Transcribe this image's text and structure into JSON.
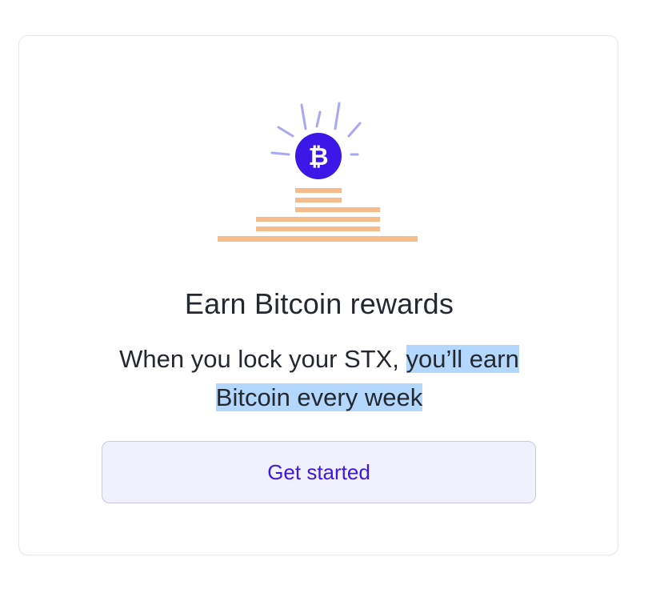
{
  "card": {
    "title": "Earn Bitcoin rewards",
    "body_plain": "When you lock your STX, ",
    "body_highlight_line1": "you’ll earn",
    "body_highlight_line2": "Bitcoin every week",
    "cta_label": "Get started"
  },
  "icons": {
    "bitcoin": "bitcoin-icon",
    "coins": "coin-stacks"
  },
  "colors": {
    "accent": "#3c18e8",
    "bitcoin_circle": "#3c18e8",
    "rays": "#a8a9f2",
    "coins": "#f6b179",
    "highlight": "#b3d7fd"
  }
}
